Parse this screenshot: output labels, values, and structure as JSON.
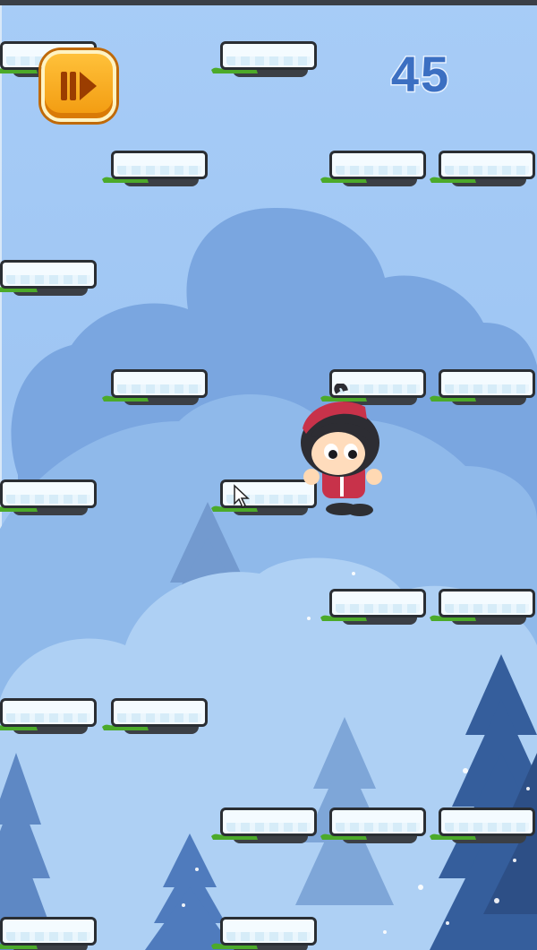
{
  "game": {
    "score": "45",
    "pause_icon": "play-pause-icon",
    "player_icon": "player-character-icon",
    "platform_icon": "snow-platform-icon",
    "colors": {
      "sky": "#a7ccf7",
      "hill": "#7aa6e0",
      "button": "#f6a91f",
      "score": "#3b6fc2"
    }
  }
}
